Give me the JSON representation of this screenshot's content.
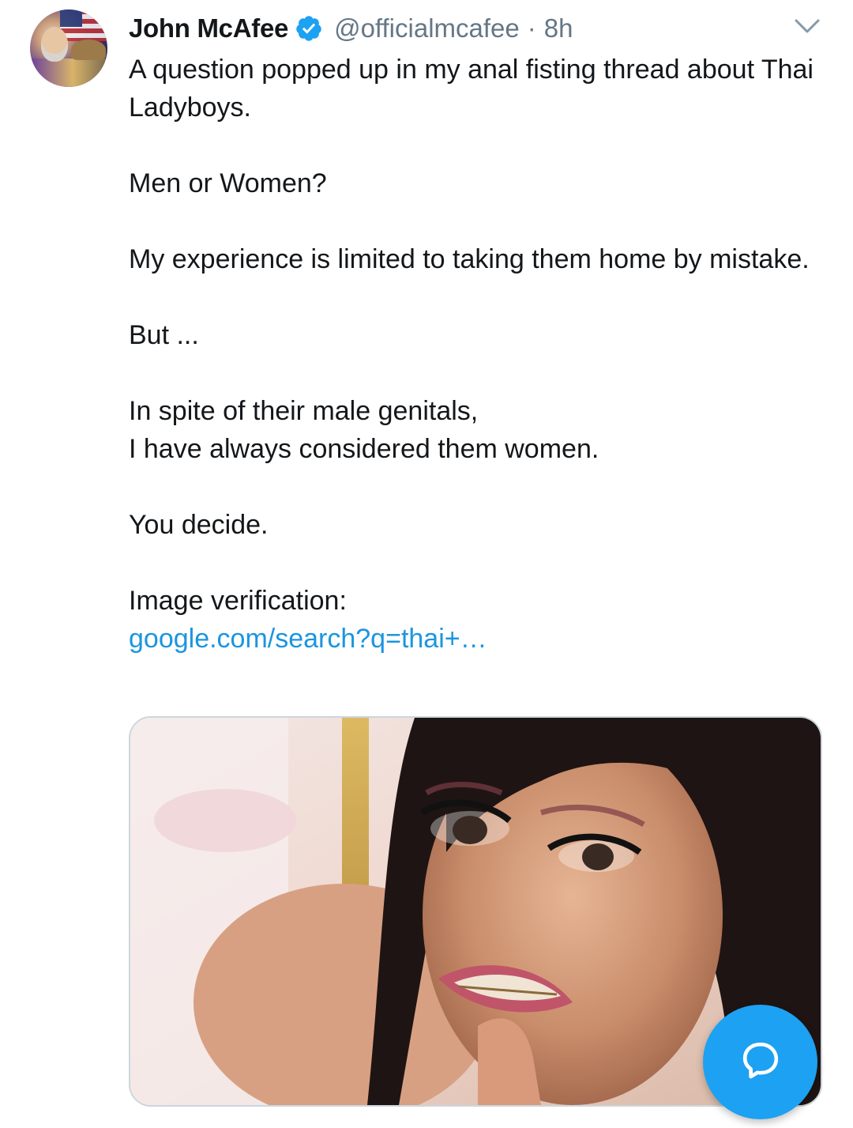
{
  "tweet": {
    "author_name": "John McAfee",
    "handle": "@officialmcafee",
    "separator": "·",
    "time": "8h",
    "verified": true,
    "lines": [
      "A question popped up in my anal fisting thread about Thai Ladyboys.",
      "",
      "Men or Women?",
      "",
      "My experience is limited to taking them home by mistake.",
      "",
      "But ...",
      "",
      "In spite of their male genitals,",
      "I have always considered them women.",
      "",
      "You decide.",
      "",
      "Image verification:"
    ],
    "link_text": "google.com/search?q=thai+…"
  },
  "icons": {
    "verified": "verified-badge-icon",
    "menu": "chevron-down-icon",
    "compose": "reply-bubble-icon"
  },
  "colors": {
    "accent": "#1da1f2",
    "link": "#1b95e0",
    "text": "#14171a",
    "muted": "#657786",
    "border": "#ccd6dd"
  }
}
